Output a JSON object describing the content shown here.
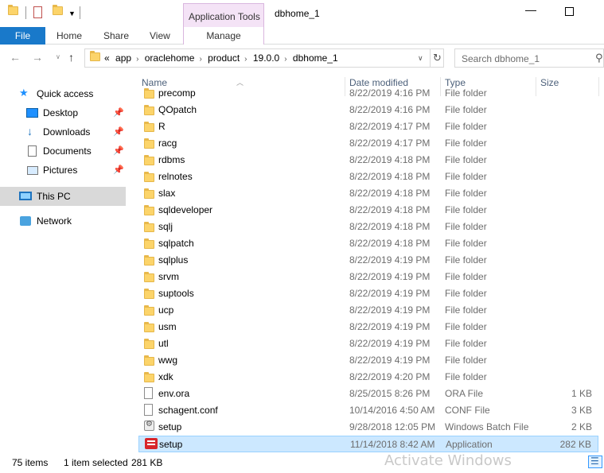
{
  "window": {
    "title": "dbhome_1",
    "context_tab_group": "Application Tools"
  },
  "ribbon": {
    "tabs": {
      "file": "File",
      "home": "Home",
      "share": "Share",
      "view": "View",
      "manage": "Manage"
    }
  },
  "address": {
    "overflow": "«",
    "crumbs": [
      "app",
      "oraclehome",
      "product",
      "19.0.0",
      "dbhome_1"
    ]
  },
  "search": {
    "placeholder": "Search dbhome_1"
  },
  "navpane": {
    "quick_access": "Quick access",
    "desktop": "Desktop",
    "downloads": "Downloads",
    "documents": "Documents",
    "pictures": "Pictures",
    "this_pc": "This PC",
    "network": "Network"
  },
  "columns": {
    "name": "Name",
    "date": "Date modified",
    "type": "Type",
    "size": "Size"
  },
  "files": [
    {
      "name": "precomp",
      "date": "8/22/2019 4:16 PM",
      "type": "File folder",
      "size": "",
      "icon": "folder"
    },
    {
      "name": "QOpatch",
      "date": "8/22/2019 4:16 PM",
      "type": "File folder",
      "size": "",
      "icon": "folder"
    },
    {
      "name": "R",
      "date": "8/22/2019 4:17 PM",
      "type": "File folder",
      "size": "",
      "icon": "folder"
    },
    {
      "name": "racg",
      "date": "8/22/2019 4:17 PM",
      "type": "File folder",
      "size": "",
      "icon": "folder"
    },
    {
      "name": "rdbms",
      "date": "8/22/2019 4:18 PM",
      "type": "File folder",
      "size": "",
      "icon": "folder"
    },
    {
      "name": "relnotes",
      "date": "8/22/2019 4:18 PM",
      "type": "File folder",
      "size": "",
      "icon": "folder"
    },
    {
      "name": "slax",
      "date": "8/22/2019 4:18 PM",
      "type": "File folder",
      "size": "",
      "icon": "folder"
    },
    {
      "name": "sqldeveloper",
      "date": "8/22/2019 4:18 PM",
      "type": "File folder",
      "size": "",
      "icon": "folder"
    },
    {
      "name": "sqlj",
      "date": "8/22/2019 4:18 PM",
      "type": "File folder",
      "size": "",
      "icon": "folder"
    },
    {
      "name": "sqlpatch",
      "date": "8/22/2019 4:18 PM",
      "type": "File folder",
      "size": "",
      "icon": "folder"
    },
    {
      "name": "sqlplus",
      "date": "8/22/2019 4:19 PM",
      "type": "File folder",
      "size": "",
      "icon": "folder"
    },
    {
      "name": "srvm",
      "date": "8/22/2019 4:19 PM",
      "type": "File folder",
      "size": "",
      "icon": "folder"
    },
    {
      "name": "suptools",
      "date": "8/22/2019 4:19 PM",
      "type": "File folder",
      "size": "",
      "icon": "folder"
    },
    {
      "name": "ucp",
      "date": "8/22/2019 4:19 PM",
      "type": "File folder",
      "size": "",
      "icon": "folder"
    },
    {
      "name": "usm",
      "date": "8/22/2019 4:19 PM",
      "type": "File folder",
      "size": "",
      "icon": "folder"
    },
    {
      "name": "utl",
      "date": "8/22/2019 4:19 PM",
      "type": "File folder",
      "size": "",
      "icon": "folder"
    },
    {
      "name": "wwg",
      "date": "8/22/2019 4:19 PM",
      "type": "File folder",
      "size": "",
      "icon": "folder"
    },
    {
      "name": "xdk",
      "date": "8/22/2019 4:20 PM",
      "type": "File folder",
      "size": "",
      "icon": "folder"
    },
    {
      "name": "env.ora",
      "date": "8/25/2015 8:26 PM",
      "type": "ORA File",
      "size": "1 KB",
      "icon": "document"
    },
    {
      "name": "schagent.conf",
      "date": "10/14/2016 4:50 AM",
      "type": "CONF File",
      "size": "3 KB",
      "icon": "document"
    },
    {
      "name": "setup",
      "date": "9/28/2018 12:05 PM",
      "type": "Windows Batch File",
      "size": "2 KB",
      "icon": "batch"
    },
    {
      "name": "setup",
      "date": "11/14/2018 8:42 AM",
      "type": "Application",
      "size": "282 KB",
      "icon": "application",
      "selected": true
    }
  ],
  "status": {
    "count": "75 items",
    "selection": "1 item selected",
    "selection_size": "281 KB",
    "watermark": "Activate Windows"
  },
  "colors": {
    "file_tab": "#1979ca",
    "context_tab": "#f4e3f6",
    "selection": "#cce8ff",
    "column_header_text": "#4c607a"
  }
}
